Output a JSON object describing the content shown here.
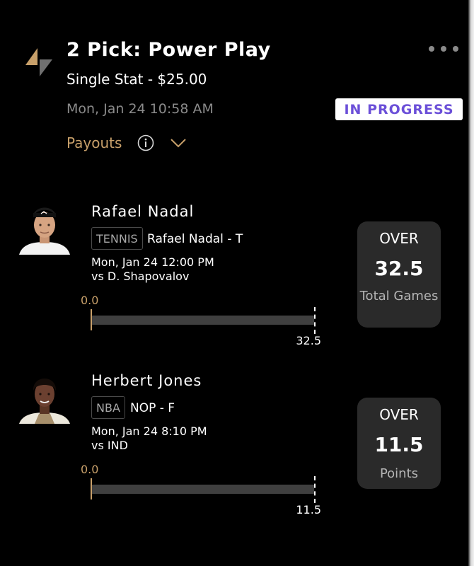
{
  "header": {
    "title": "2 Pick: Power Play",
    "subtitle": "Single Stat - $25.00",
    "datetime": "Mon, Jan 24 10:58 AM",
    "status": "IN PROGRESS",
    "payouts_label": "Payouts"
  },
  "icons": {
    "logo": "prizepicks-logo",
    "more": "more-dots-icon",
    "info": "info-icon",
    "chevron": "chevron-down-icon"
  },
  "colors": {
    "accent_gold": "#c8a06a",
    "status_purple": "#6b4fd8",
    "card_bg": "#2a2a2a"
  },
  "picks": [
    {
      "player": "Rafael Nadal",
      "league": "TENNIS",
      "team_pos": "Rafael Nadal - T",
      "game_time": "Mon, Jan 24 12:00 PM",
      "opponent": "vs D. Shapovalov",
      "start_value": "0.0",
      "end_value": "32.5",
      "progress": 0.0,
      "direction": "OVER",
      "line": "32.5",
      "stat": "Total Games"
    },
    {
      "player": "Herbert Jones",
      "league": "NBA",
      "team_pos": "NOP - F",
      "game_time": "Mon, Jan 24 8:10 PM",
      "opponent": "vs IND",
      "start_value": "0.0",
      "end_value": "11.5",
      "progress": 0.0,
      "direction": "OVER",
      "line": "11.5",
      "stat": "Points"
    }
  ]
}
